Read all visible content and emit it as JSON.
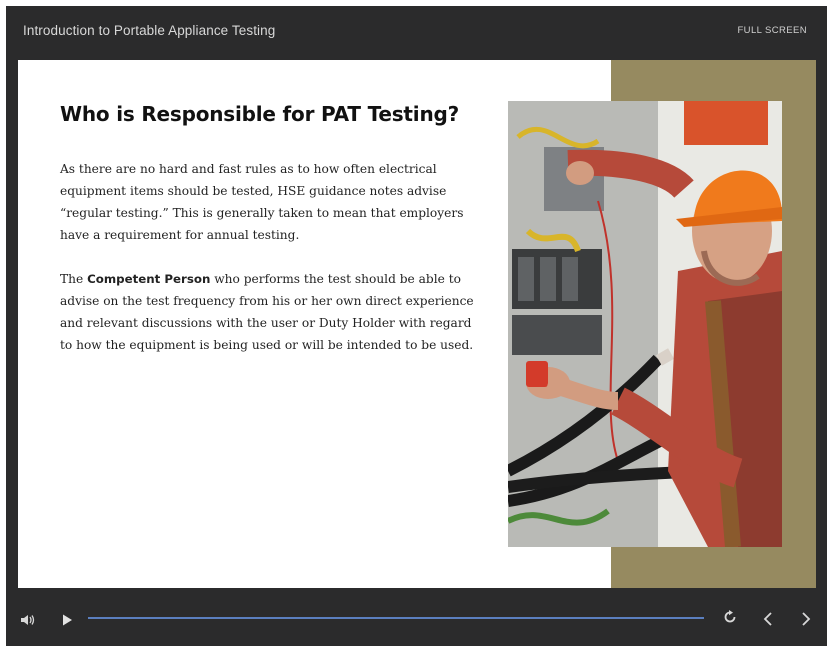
{
  "header": {
    "course_title": "Introduction to Portable Appliance Testing",
    "fullscreen_label": "FULL SCREEN"
  },
  "slide": {
    "heading": "Who is Responsible for PAT Testing?",
    "paragraph1": "As there are no hard and fast rules as to how often electrical equipment items should be tested, HSE guidance notes advise “regular testing.” This is generally taken to mean that employers have a requirement for annual testing.",
    "paragraph2_prefix": "The ",
    "paragraph2_bold": "Competent Person",
    "paragraph2_rest": " who performs the test should be able to advise on the test frequency from his or her own direct experience and relevant discussions with the user or Duty Holder with regard to how the equipment is being used or will be intended to be used.",
    "side_panel_color": "#968a60",
    "image_icon": "electrician-testing-panel-photo"
  },
  "controls": {
    "volume_icon": "volume-icon",
    "play_icon": "play-icon",
    "replay_icon": "replay-icon",
    "prev_icon": "chevron-left-icon",
    "next_icon": "chevron-right-icon",
    "progress_fraction": 0.0,
    "accent_color": "#5b7fbf"
  }
}
